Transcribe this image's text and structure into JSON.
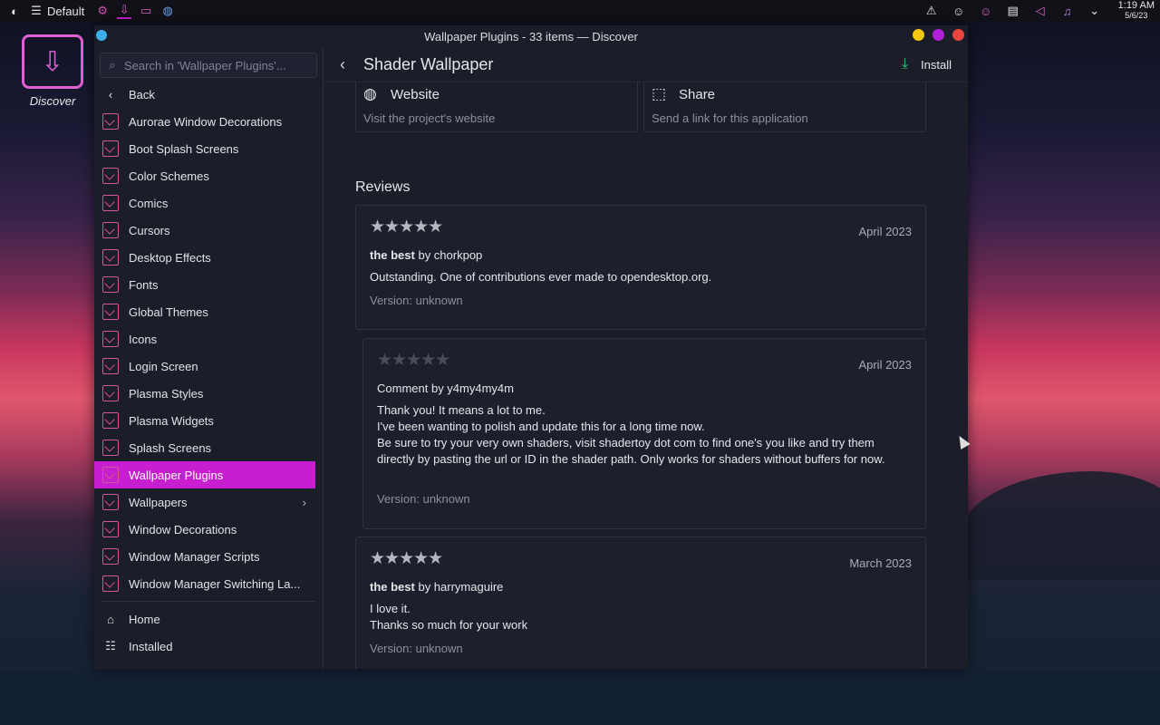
{
  "panel": {
    "activity_label": "Default",
    "clock_time": "1:19 AM",
    "clock_date": "5/6/23"
  },
  "desktop": {
    "discover_icon_label": "Discover"
  },
  "window": {
    "title": "Wallpaper Plugins - 33 items — Discover",
    "controls": {
      "minimize_color": "#f2c811",
      "maximize_color": "#b120d8",
      "close_color": "#e8463d"
    }
  },
  "sidebar": {
    "search_placeholder": "Search in 'Wallpaper Plugins'...",
    "back_label": "Back",
    "items": [
      {
        "label": "Aurorae Window Decorations"
      },
      {
        "label": "Boot Splash Screens"
      },
      {
        "label": "Color Schemes"
      },
      {
        "label": "Comics"
      },
      {
        "label": "Cursors"
      },
      {
        "label": "Desktop Effects"
      },
      {
        "label": "Fonts"
      },
      {
        "label": "Global Themes"
      },
      {
        "label": "Icons"
      },
      {
        "label": "Login Screen"
      },
      {
        "label": "Plasma Styles"
      },
      {
        "label": "Plasma Widgets"
      },
      {
        "label": "Splash Screens"
      },
      {
        "label": "Wallpaper Plugins",
        "selected": true
      },
      {
        "label": "Wallpapers"
      },
      {
        "label": "Window Decorations"
      },
      {
        "label": "Window Manager Scripts"
      },
      {
        "label": "Window Manager Switching La..."
      }
    ],
    "bottom": [
      {
        "label": "Home"
      },
      {
        "label": "Installed"
      }
    ],
    "accent": "#c71fd0"
  },
  "header": {
    "title": "Shader Wallpaper",
    "install_label": "Install"
  },
  "links": {
    "website": {
      "title": "Website",
      "subtitle": "Visit the project's website"
    },
    "share": {
      "title": "Share",
      "subtitle": "Send a link for this application"
    }
  },
  "reviews": {
    "heading": "Reviews",
    "items": [
      {
        "rating": 5,
        "date": "April 2023",
        "summary": "the best",
        "by": "by chorkpop",
        "body": [
          "Outstanding. One of  contributions ever made to opendesktop.org."
        ],
        "version": "Version: unknown"
      },
      {
        "rating": 0,
        "date": "April 2023",
        "summary": "",
        "by": "Comment by y4my4my4m",
        "body": [
          "Thank you! It means a lot to me.",
          "I've been wanting to polish and update this for a long time now.",
          "Be sure to try your very own shaders, visit shadertoy dot com to find one's you like and try them directly by pasting the url or ID in the shader path. Only works for shaders without buffers for now."
        ],
        "version": "Version: unknown"
      },
      {
        "rating": 5,
        "date": "March 2023",
        "summary": "the best",
        "by": "by harrymaguire",
        "body": [
          "I love it.",
          "Thanks so much for your work"
        ],
        "version": "Version: unknown"
      }
    ]
  }
}
